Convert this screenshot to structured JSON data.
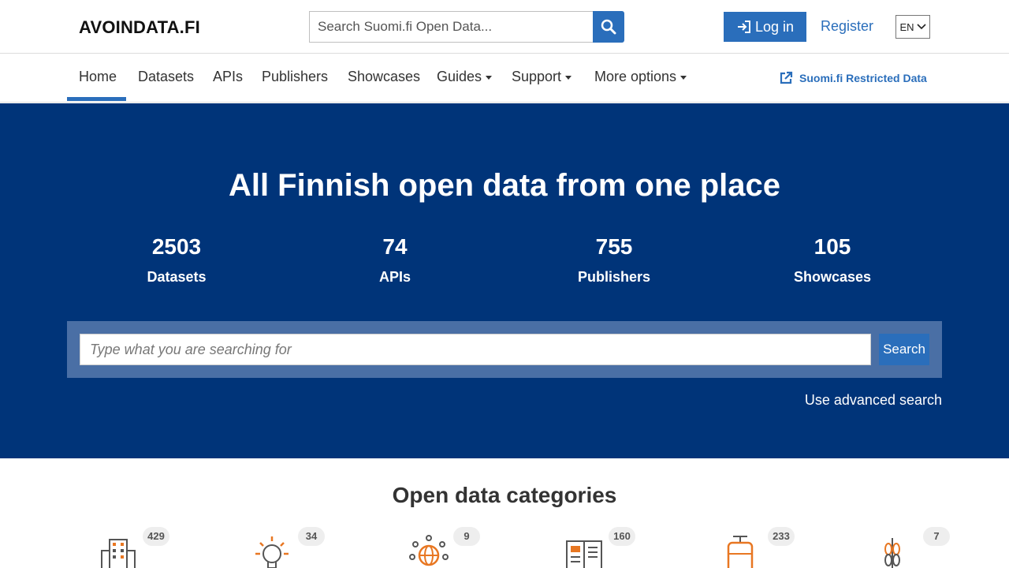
{
  "header": {
    "logo": "AVOINDATA.FI",
    "search_placeholder": "Search Suomi.fi Open Data...",
    "login_label": "Log in",
    "register_label": "Register",
    "language": "EN"
  },
  "nav": {
    "items": [
      {
        "label": "Home",
        "active": true
      },
      {
        "label": "Datasets"
      },
      {
        "label": "APIs"
      },
      {
        "label": "Publishers"
      },
      {
        "label": "Showcases"
      },
      {
        "label": "Guides",
        "dropdown": true
      },
      {
        "label": "Support",
        "dropdown": true
      },
      {
        "label": "More options",
        "dropdown": true
      }
    ],
    "restricted_link": "Suomi.fi Restricted Data"
  },
  "hero": {
    "title": "All Finnish open data from one place",
    "stats": [
      {
        "value": "2503",
        "label": "Datasets"
      },
      {
        "value": "74",
        "label": "APIs"
      },
      {
        "value": "755",
        "label": "Publishers"
      },
      {
        "value": "105",
        "label": "Showcases"
      }
    ],
    "search_placeholder": "Type what you are searching for",
    "search_button": "Search",
    "advanced_search": "Use advanced search"
  },
  "categories": {
    "title": "Open data categories",
    "items": [
      {
        "icon": "building-icon",
        "count": "429"
      },
      {
        "icon": "lightbulb-icon",
        "count": "34"
      },
      {
        "icon": "globe-network-icon",
        "count": "9"
      },
      {
        "icon": "newspaper-icon",
        "count": "160"
      },
      {
        "icon": "tram-icon",
        "count": "233"
      },
      {
        "icon": "wheat-icon",
        "count": "7"
      }
    ]
  },
  "colors": {
    "primary": "#2a6ebb",
    "hero_background": "#003479",
    "search_panel": "#4a6fa5",
    "icon_accent": "#e87722"
  }
}
